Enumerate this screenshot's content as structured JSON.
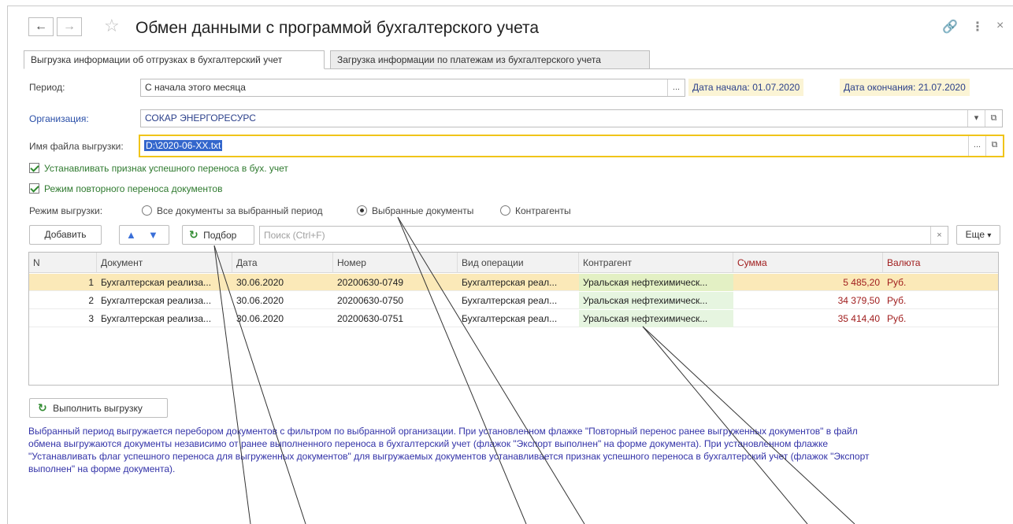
{
  "header": {
    "title": "Обмен данными с программой бухгалтерского учета",
    "back_icon": "arrow-left",
    "forward_icon": "arrow-right",
    "favorite_icon": "star",
    "link_icon": "link",
    "more_icon": "more-vertical",
    "close_icon": "close"
  },
  "tabs": [
    {
      "label": "Выгрузка информации об отгрузках в бухгалтерский учет",
      "active": true
    },
    {
      "label": "Загрузка информации по платежам из бухгалтерского учета",
      "active": false
    }
  ],
  "form": {
    "period_label": "Период:",
    "period_value": "С начала этого месяца",
    "start_label": "Дата начала:",
    "start_value": "01.07.2020",
    "end_label": "Дата окончания:",
    "end_value": "21.07.2020",
    "org_label": "Организация:",
    "org_value": "СОКАР ЭНЕРГОРЕСУРС",
    "file_label": "Имя файла выгрузки:",
    "file_value": "D:\\2020-06-XX.txt",
    "check_success_label": "Устанавливать признак успешного переноса в бух. учет",
    "check_repeat_label": "Режим повторного переноса документов",
    "mode_label": "Режим выгрузки:",
    "mode_options": [
      "Все документы за выбранный период",
      "Выбранные документы",
      "Контрагенты"
    ],
    "mode_selected": "Выбранные документы",
    "select_button_label": "...",
    "dropdown_icon": "chevron-down",
    "open_icon": "open-window"
  },
  "toolbar": {
    "add_label": "Добавить",
    "pick_label": "Подбор",
    "search_placeholder": "Поиск (Ctrl+F)",
    "more_label": "Еще",
    "clear_icon": "×",
    "more_icon": "▾"
  },
  "table": {
    "columns": [
      "N",
      "Документ",
      "Дата",
      "Номер",
      "Вид операции",
      "Контрагент",
      "Сумма",
      "Валюта"
    ],
    "rows": [
      {
        "n": "1",
        "doc": "Бухгалтерская реализа...",
        "date": "30.06.2020",
        "number": "20200630-0749",
        "op": "Бухгалтерская реал...",
        "contractor": "Уральская нефтехимическ...",
        "sum": "5 485,20",
        "currency": "Руб."
      },
      {
        "n": "2",
        "doc": "Бухгалтерская реализа...",
        "date": "30.06.2020",
        "number": "20200630-0750",
        "op": "Бухгалтерская реал...",
        "contractor": "Уральская нефтехимическ...",
        "sum": "34 379,50",
        "currency": "Руб."
      },
      {
        "n": "3",
        "doc": "Бухгалтерская реализа...",
        "date": "30.06.2020",
        "number": "20200630-0751",
        "op": "Бухгалтерская реал...",
        "contractor": "Уральская нефтехимическ...",
        "sum": "35 414,40",
        "currency": "Руб."
      }
    ],
    "selected_row": 1
  },
  "execute_label": "Выполнить выгрузку",
  "note_lines": [
    "Выбранный период выгружается перебором документов с фильтром по выбранной организации. При установленном флажке \"Повторный перенос ранее выгруженных документов\" в файл",
    "обмена выгружаются документы независимо от ранее выполненного переноса в бухгалтерский учет (флажок \"Экспорт выполнен\" на форме документа). При установленном флажке",
    "\"Устанавливать флаг успешного переноса для выгруженных документов\" для выгружаемых документов устанавливается признак успешного переноса в бухгалтерский учет (флажок \"Экспорт",
    "выполнен\" на форме документа)."
  ],
  "colors": {
    "selected_row": "#fbe9b8",
    "contractor_cell": "#e6f5e0",
    "sum_text": "#a01d1d",
    "info_box": "#fbf4d5",
    "check_green": "#2f8a2f",
    "file_border": "#f0c419"
  }
}
